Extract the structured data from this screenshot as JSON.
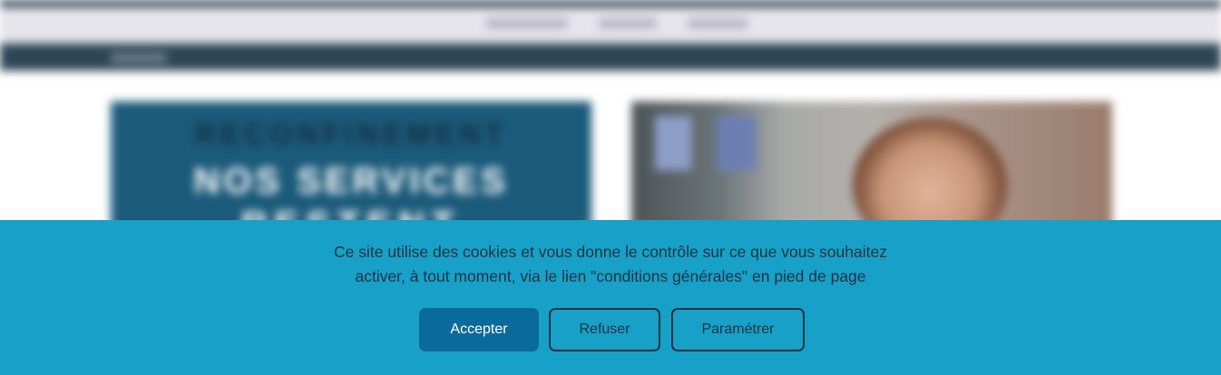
{
  "background_page": {
    "nav_links": [
      {
        "label_width_hint": "short"
      },
      {
        "label_width_hint": "short"
      },
      {
        "label_width_hint": "short"
      }
    ],
    "promo_card": {
      "line1": "RECONFINEMENT",
      "line2": "NOS SERVICES",
      "line3": "RESTENT"
    }
  },
  "cookie_banner": {
    "message_line1": "Ce site utilise des cookies et vous donne le contrôle sur ce que vous souhaitez",
    "message_line2": "activer, à tout moment, via le lien \"conditions générales\" en pied de page",
    "accept_label": "Accepter",
    "refuse_label": "Refuser",
    "settings_label": "Paramétrer"
  },
  "colors": {
    "banner_bg": "#17a0c8",
    "accept_bg": "#0b6a9c",
    "dark_text": "#1d3440",
    "header_dark": "#2e4656"
  }
}
